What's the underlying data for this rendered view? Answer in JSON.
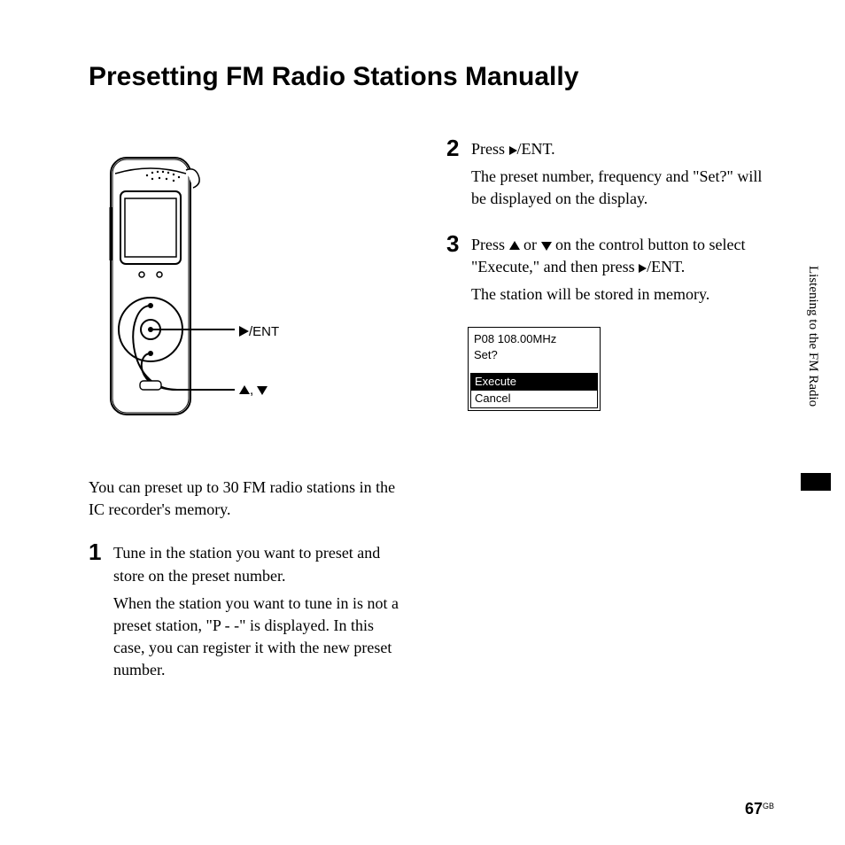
{
  "title": "Presetting FM Radio Stations Manually",
  "labels": {
    "ent": "/ENT",
    "updown_sep": ", "
  },
  "intro": "You can preset up to 30 FM radio stations in the IC recorder's memory.",
  "steps": {
    "s1": {
      "num": "1",
      "p1": "Tune in the station you want to preset and store on the preset number.",
      "p2": "When the station you want to tune in is not a preset station, \"P - -\" is displayed. In this case, you can register it with the new preset number."
    },
    "s2": {
      "num": "2",
      "p1_a": "Press ",
      "p1_b": "/ENT.",
      "p2": "The preset number, frequency and \"Set?\" will be displayed on the display."
    },
    "s3": {
      "num": "3",
      "p1_a": "Press ",
      "p1_b": " or ",
      "p1_c": " on the control button to select \"Execute,\" and then press ",
      "p1_d": "/ENT.",
      "p2": "The station will be stored in memory."
    }
  },
  "screen": {
    "line1": "P08   108.00MHz",
    "line2": "Set?",
    "opt1": "Execute",
    "opt2": "Cancel"
  },
  "side_tab": "Listening to the FM Radio",
  "page_number": "67",
  "page_suffix": "GB"
}
